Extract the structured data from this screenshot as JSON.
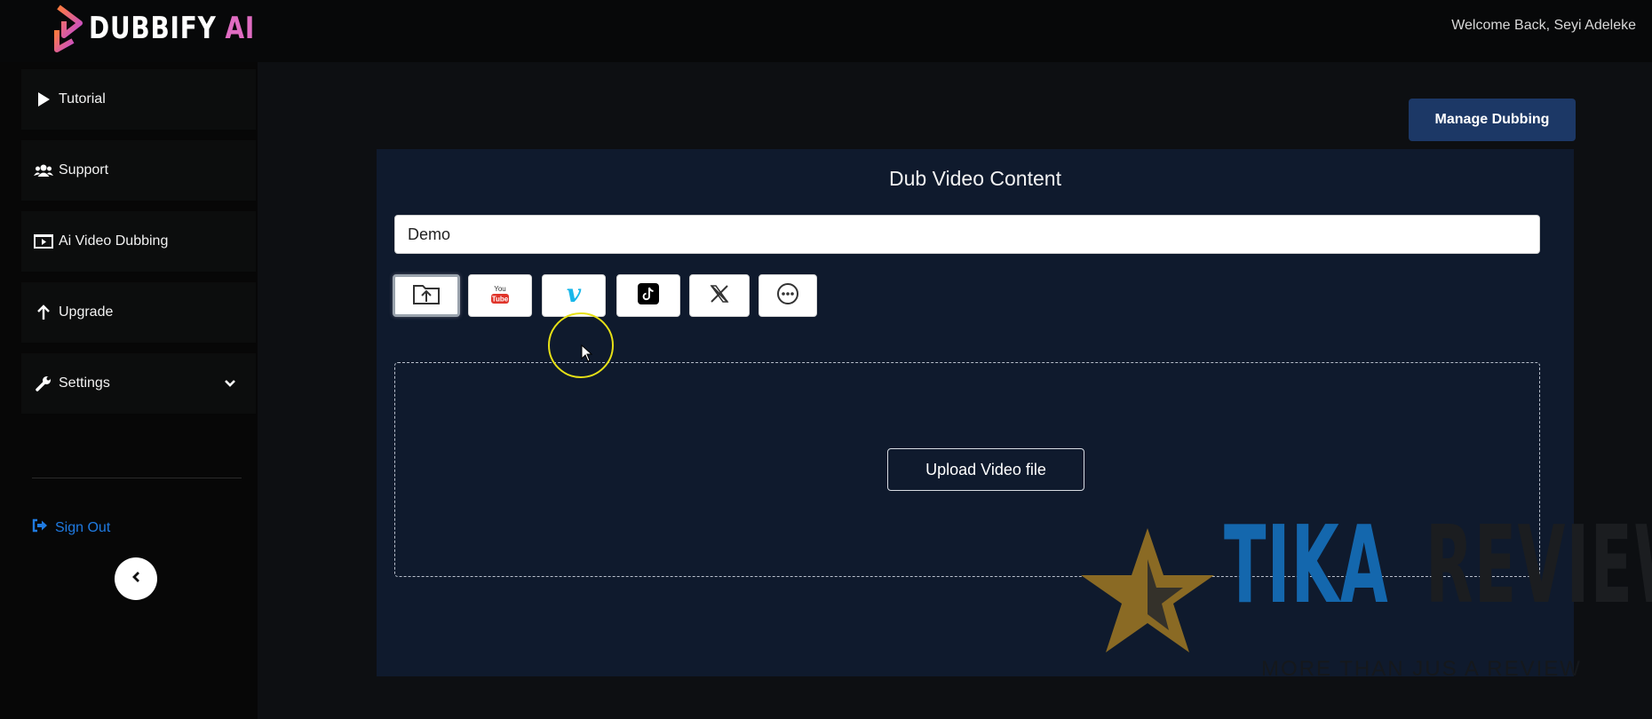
{
  "header": {
    "logo_text_1": "DUBBIFY",
    "logo_text_2": "AI",
    "welcome": "Welcome Back, Seyi Adeleke"
  },
  "sidebar": {
    "items": [
      {
        "label": "Tutorial",
        "icon": "play-icon"
      },
      {
        "label": "Support",
        "icon": "users-icon"
      },
      {
        "label": "Ai Video Dubbing",
        "icon": "video-icon"
      },
      {
        "label": "Upgrade",
        "icon": "arrow-up-icon"
      },
      {
        "label": "Settings",
        "icon": "wrench-icon"
      }
    ],
    "sign_out": "Sign Out"
  },
  "main": {
    "manage_button": "Manage Dubbing",
    "card_title": "Dub Video Content",
    "title_input_value": "Demo",
    "sources": [
      {
        "name": "upload",
        "icon": "upload-folder-icon",
        "active": true
      },
      {
        "name": "youtube",
        "icon": "youtube-icon",
        "label": "You Tube"
      },
      {
        "name": "vimeo",
        "icon": "vimeo-icon",
        "label": "v"
      },
      {
        "name": "tiktok",
        "icon": "tiktok-icon"
      },
      {
        "name": "x",
        "icon": "x-icon",
        "label": "X"
      },
      {
        "name": "more",
        "icon": "more-icon"
      }
    ],
    "upload_button": "Upload Video file"
  },
  "watermark": {
    "word1": "TIKA",
    "word2": "REVIEW",
    "tagline": "MORE THAN JUS A REVIEW"
  },
  "colors": {
    "accent_blue": "#1c3866",
    "link_blue": "#1f7ae0",
    "card_bg": "#0f1a2d",
    "cursor_ring": "#e6e016"
  }
}
